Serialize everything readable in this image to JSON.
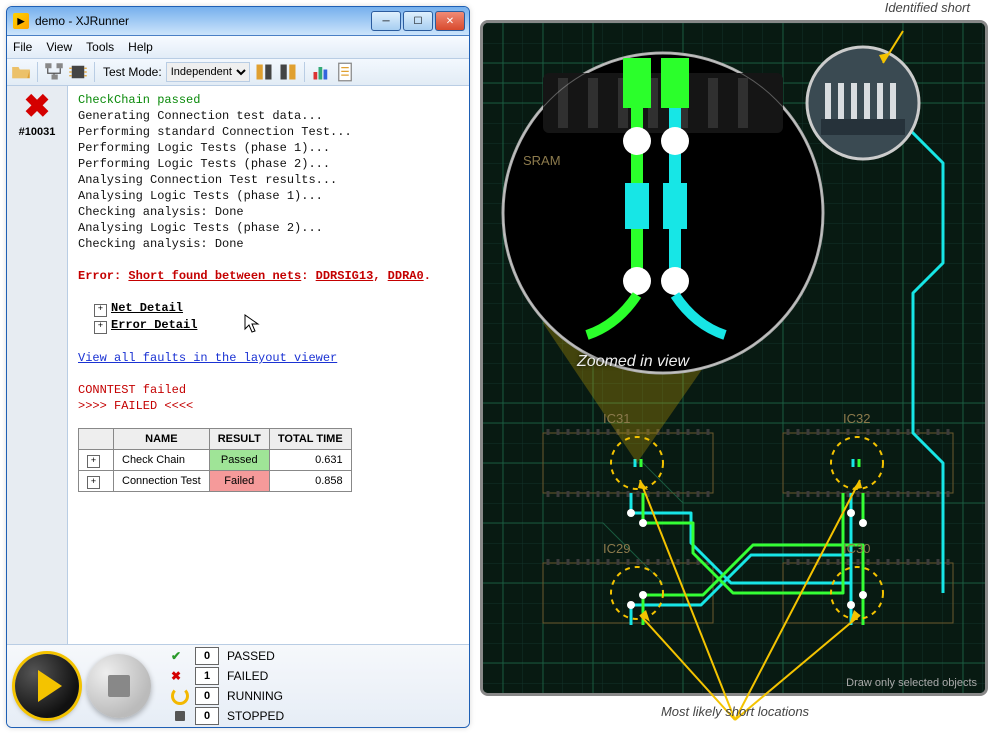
{
  "annotations": {
    "top": "Identified short",
    "zoom": "Zoomed in view",
    "bottom": "Most likely short locations",
    "footer": "Draw only selected objects"
  },
  "window": {
    "title": "demo - XJRunner",
    "menu": [
      "File",
      "View",
      "Tools",
      "Help"
    ],
    "toolbar": {
      "test_mode_label": "Test Mode:",
      "test_mode_value": "Independent"
    },
    "run_id": "#10031",
    "log_lines": {
      "l0": "CheckChain passed",
      "l1": "Generating Connection test data...",
      "l2": "Performing standard Connection Test...",
      "l3": "Performing Logic Tests (phase 1)...",
      "l4": "Performing Logic Tests (phase 2)...",
      "l5": "Analysing Connection Test results...",
      "l6": "Analysing Logic Tests (phase 1)...",
      "l7": "Checking analysis: Done",
      "l8": "Analysing Logic Tests (phase 2)...",
      "l9": "Checking analysis: Done",
      "err_prefix": "Error: ",
      "err_link": "Short found between nets",
      "err_sep": ": ",
      "err_net1": "DDRSIG13",
      "err_c": ", ",
      "err_net2": "DDRA0",
      "err_dot": ".",
      "net_detail": "Net Detail",
      "error_detail": "Error Detail",
      "view_faults": "View all faults in the layout viewer",
      "conntest": "CONNTEST failed",
      "failed_banner": ">>>> FAILED <<<<"
    },
    "results_table": {
      "headers": [
        "NAME",
        "RESULT",
        "TOTAL TIME"
      ],
      "rows": [
        {
          "name": "Check Chain",
          "result": "Passed",
          "time": "0.631",
          "status": "pass"
        },
        {
          "name": "Connection Test",
          "result": "Failed",
          "time": "0.858",
          "status": "fail"
        }
      ]
    },
    "status": {
      "passed": {
        "count": "0",
        "label": "PASSED"
      },
      "failed": {
        "count": "1",
        "label": "FAILED"
      },
      "running": {
        "count": "0",
        "label": "RUNNING"
      },
      "stopped": {
        "count": "0",
        "label": "STOPPED"
      }
    }
  },
  "pcb": {
    "sram_label": "SRAM",
    "ic": {
      "ic29": "IC29",
      "ic30": "IC30",
      "ic31": "IC31",
      "ic32": "IC32"
    }
  }
}
